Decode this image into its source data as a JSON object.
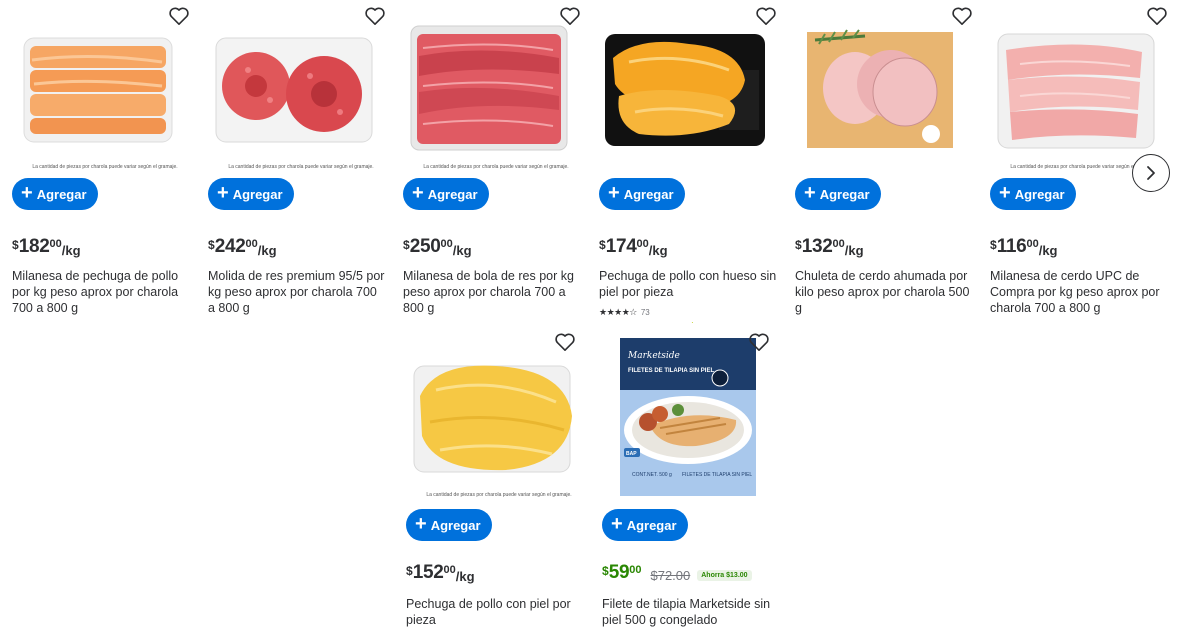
{
  "add_label": "Agregar",
  "products": [
    {
      "name": "Milanesa de pechuga de pollo por kg peso aprox por charola 700 a 800 g",
      "currency": "$",
      "price_int": "182",
      "price_cents": "00",
      "unit": "/kg",
      "disclaimer": "La cantidad de piezas por charola puede variar según el gramaje."
    },
    {
      "name": "Molida de res premium 95/5 por kg peso aprox por charola 700 a 800 g",
      "currency": "$",
      "price_int": "242",
      "price_cents": "00",
      "unit": "/kg",
      "disclaimer": "La cantidad de piezas por charola puede variar según el gramaje."
    },
    {
      "name": "Milanesa de bola de res por kg peso aprox por charola 700 a 800 g",
      "currency": "$",
      "price_int": "250",
      "price_cents": "00",
      "unit": "/kg",
      "disclaimer": "La cantidad de piezas por charola puede variar según el gramaje."
    },
    {
      "name": "Pechuga de pollo con hueso sin piel por pieza",
      "currency": "$",
      "price_int": "174",
      "price_cents": "00",
      "unit": "/kg",
      "rating_stars": "★★★★☆",
      "rating_count": "73"
    },
    {
      "name": "Chuleta de cerdo ahumada por kilo peso aprox por charola 500 g",
      "currency": "$",
      "price_int": "132",
      "price_cents": "00",
      "unit": "/kg"
    },
    {
      "name": "Milanesa de cerdo UPC de Compra por kg peso aprox por charola 700 a 800 g",
      "currency": "$",
      "price_int": "116",
      "price_cents": "00",
      "unit": "/kg",
      "disclaimer": "La cantidad de piezas por charola puede variar según el gramaje."
    },
    {
      "name": "Pechuga de pollo con piel por pieza",
      "currency": "$",
      "price_int": "152",
      "price_cents": "00",
      "unit": "/kg",
      "disclaimer": "La cantidad de piezas por charola puede variar según el gramaje."
    },
    {
      "name": "Filete de tilapia Marketside sin piel 500 g congelado",
      "currency": "$",
      "price_int": "59",
      "price_cents": "00",
      "was_price": "$72.00",
      "savings": "Ahorra $13.00",
      "sale_color": "#2a8703",
      "package_brand": "Marketside",
      "package_title": "FILETES DE TILAPIA SIN PIEL",
      "package_net": "CONT.NET. 500 g",
      "package_sub": "FILETES DE TILAPIA SIN PIEL",
      "package_badge": "BAP"
    }
  ],
  "icons": {
    "favorite": "heart-outline-icon",
    "add": "plus-icon",
    "next": "chevron-right-icon",
    "star": "star-icon"
  },
  "colors": {
    "primary_button": "#0071dc",
    "text": "#2e2f32",
    "sale": "#2a8703",
    "muted": "#74767c"
  }
}
